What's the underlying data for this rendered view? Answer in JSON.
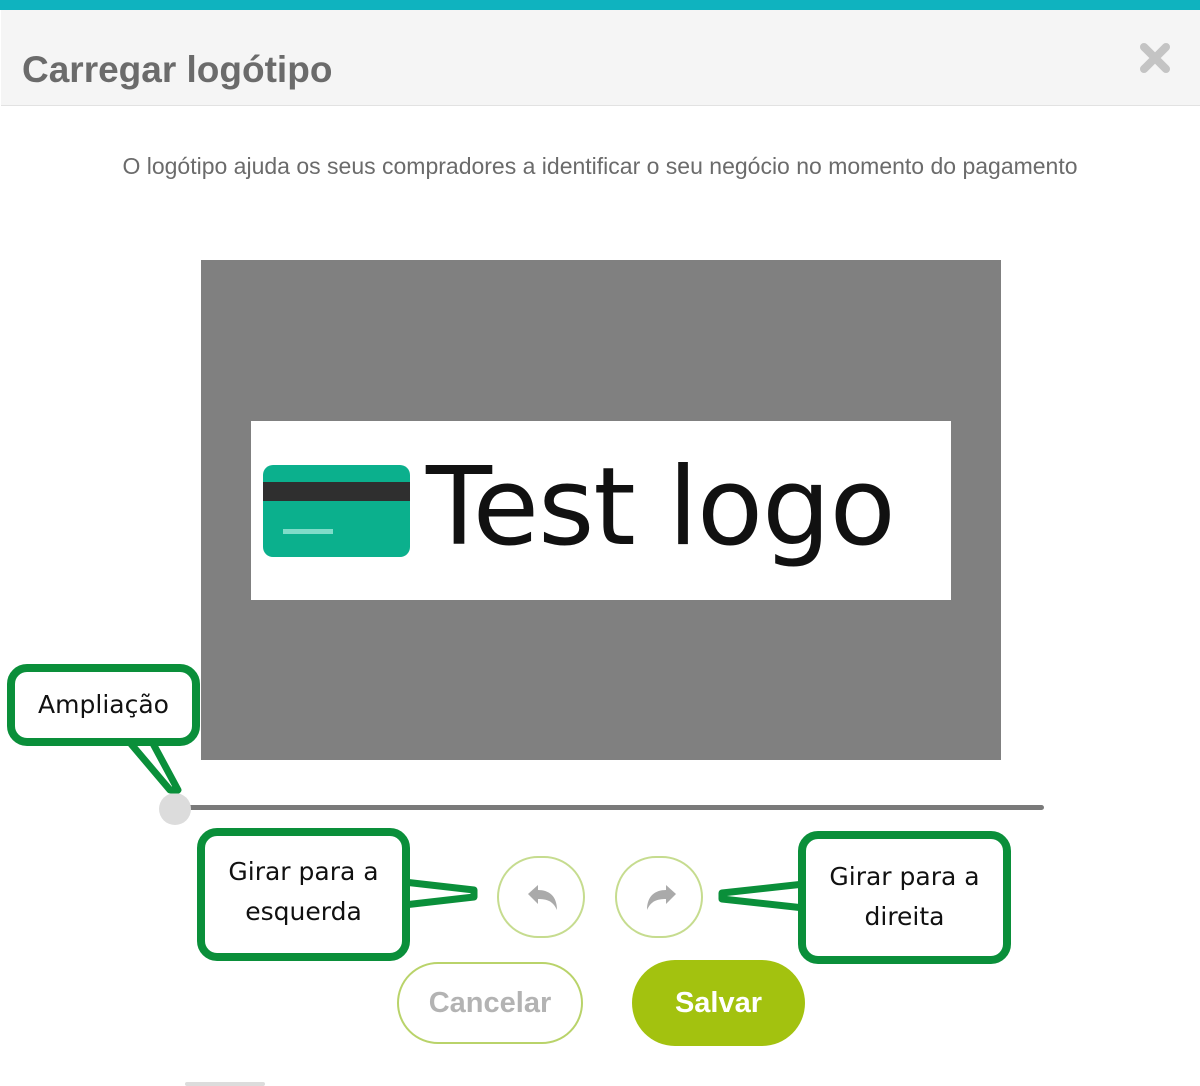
{
  "dialog": {
    "title": "Carregar logótipo",
    "description": "O logótipo ajuda os seus compradores a identificar o seu negócio no momento do pagamento",
    "close_icon": "close-icon"
  },
  "preview": {
    "logo_text": "Test logo",
    "logo_icon": "credit-card-icon"
  },
  "zoom": {
    "value": 0,
    "max": 1
  },
  "rotate": {
    "left_icon": "rotate-left-icon",
    "right_icon": "rotate-right-icon"
  },
  "buttons": {
    "cancel": "Cancelar",
    "save": "Salvar"
  },
  "annotations": {
    "zoom": "Ampliação",
    "rotate_left": [
      "Girar para a",
      "esquerda"
    ],
    "rotate_right": [
      "Girar para a",
      "direita"
    ]
  },
  "colors": {
    "accent_top": "#0fb3bf",
    "save": "#a3c20f",
    "callout_border": "#0a8f3a"
  }
}
